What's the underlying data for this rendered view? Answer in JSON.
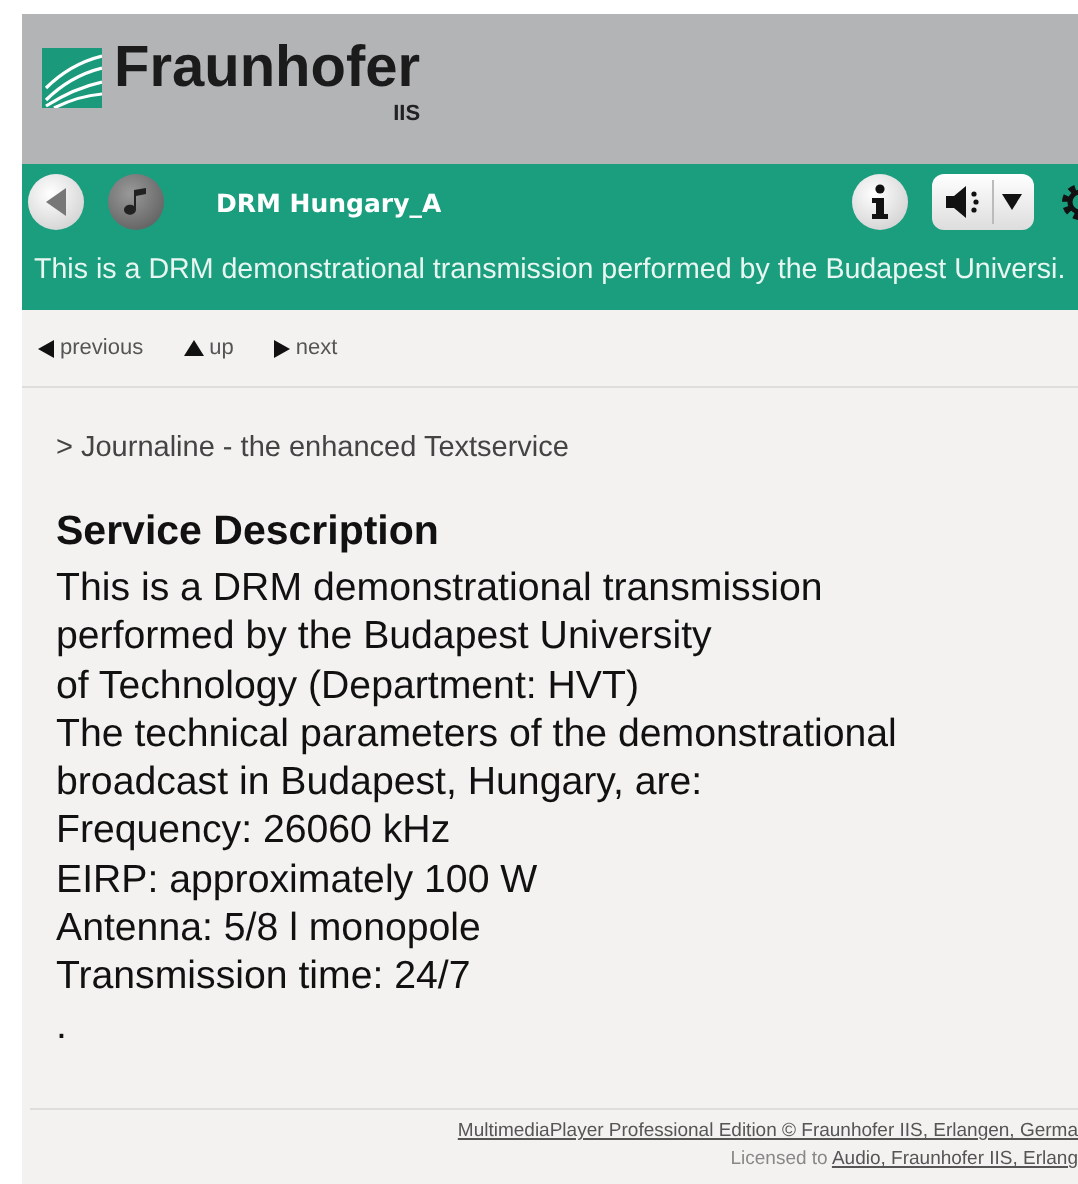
{
  "header": {
    "logo_text": "Fraunhofer",
    "logo_subtext": "IIS"
  },
  "service_bar": {
    "title": "DRM Hungary_A",
    "ticker": "This is a DRM demonstrational transmission performed by the Budapest Universi."
  },
  "nav": [
    {
      "label": "previous",
      "kind": "left"
    },
    {
      "label": "up",
      "kind": "up"
    },
    {
      "label": "next",
      "kind": "right"
    }
  ],
  "breadcrumb": "> Journaline - the enhanced Textservice",
  "article": {
    "heading": "Service Description",
    "lines": [
      "This is a DRM demonstrational transmission",
      "performed by the Budapest University",
      "of Technology (Department: HVT)",
      "The technical parameters of the demonstrational",
      "broadcast in Budapest, Hungary, are:",
      "Frequency: 26060 kHz",
      "EIRP: approximately 100 W",
      "Antenna: 5/8 l monopole",
      "Transmission time: 24/7",
      "."
    ]
  },
  "footer": {
    "line1": "MultimediaPlayer Professional Edition © Fraunhofer IIS, Erlangen, Germa",
    "license_label": "Licensed to",
    "license_link": "Audio, Fraunhofer IIS, Erlang"
  }
}
